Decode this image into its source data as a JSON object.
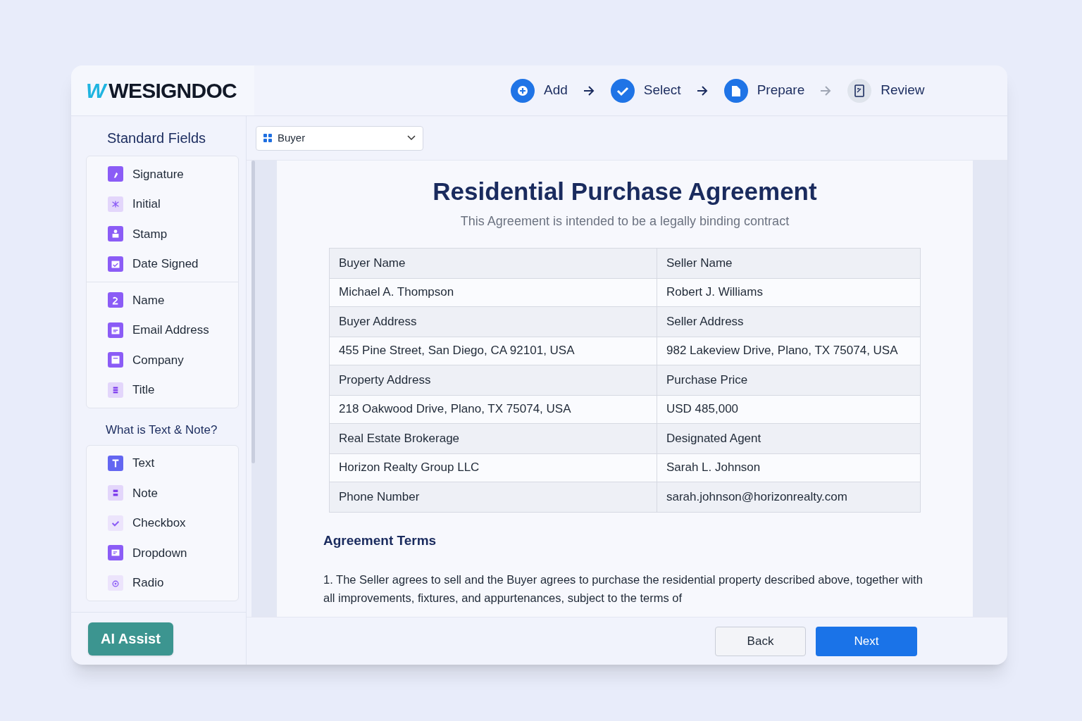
{
  "logo": {
    "mark": "W",
    "name": "WESIGNDOC"
  },
  "steps": [
    {
      "label": "Add",
      "kind": "add",
      "done": true
    },
    {
      "label": "Select",
      "kind": "select",
      "done": true
    },
    {
      "label": "Prepare",
      "kind": "prepare",
      "done": true
    },
    {
      "label": "Review",
      "kind": "review",
      "done": false
    }
  ],
  "sidebar": {
    "sections": [
      {
        "title": "Standard Fields",
        "groups": [
          [
            {
              "label": "Signature",
              "kind": "signature"
            },
            {
              "label": "Initial",
              "kind": "initial"
            },
            {
              "label": "Stamp",
              "kind": "stamp"
            },
            {
              "label": "Date Signed",
              "kind": "date"
            }
          ],
          [
            {
              "label": "Name",
              "kind": "name"
            },
            {
              "label": "Email Address",
              "kind": "email"
            },
            {
              "label": "Company",
              "kind": "company"
            },
            {
              "label": "Title",
              "kind": "title"
            }
          ]
        ]
      },
      {
        "title": "What is Text & Note?",
        "groups": [
          [
            {
              "label": "Text",
              "kind": "text"
            },
            {
              "label": "Note",
              "kind": "note"
            },
            {
              "label": "Checkbox",
              "kind": "checkbox"
            },
            {
              "label": "Dropdown",
              "kind": "dropdown"
            },
            {
              "label": "Radio",
              "kind": "radio"
            }
          ]
        ]
      }
    ],
    "ai_button": "AI Assist"
  },
  "recipient_select": {
    "value": "Buyer"
  },
  "document": {
    "title": "Residential Purchase Agreement",
    "subtitle": "This Agreement is intended to be a legally binding contract",
    "table": {
      "rows": [
        {
          "kind": "label",
          "cells": [
            "Buyer Name",
            "Seller Name"
          ]
        },
        {
          "kind": "value",
          "cells": [
            "Michael A. Thompson",
            "Robert J. Williams"
          ]
        },
        {
          "kind": "label",
          "cells": [
            "Buyer Address",
            "Seller Address"
          ]
        },
        {
          "kind": "value",
          "cells": [
            "455 Pine Street, San Diego, CA 92101, USA",
            "982 Lakeview Drive, Plano, TX 75074, USA"
          ]
        },
        {
          "kind": "label",
          "cells": [
            "Property Address",
            "Purchase Price"
          ]
        },
        {
          "kind": "value",
          "cells": [
            "218 Oakwood Drive, Plano, TX 75074, USA",
            "USD 485,000"
          ]
        },
        {
          "kind": "label",
          "cells": [
            "Real Estate Brokerage",
            "Designated Agent"
          ]
        },
        {
          "kind": "value",
          "cells": [
            "Horizon Realty Group LLC",
            "Sarah L. Johnson"
          ]
        },
        {
          "kind": "label",
          "cells": [
            "Phone Number",
            "sarah.johnson@horizonrealty.com"
          ]
        }
      ]
    },
    "section_title": "Agreement Terms",
    "paragraph": "1. The Seller agrees to sell and the Buyer agrees to purchase the residential property described above, together with all improvements, fixtures, and appurtenances, subject to the terms of"
  },
  "footer": {
    "buttons": [
      {
        "label": "Back",
        "kind": "secondary"
      },
      {
        "label": "Next",
        "kind": "primary"
      }
    ]
  }
}
